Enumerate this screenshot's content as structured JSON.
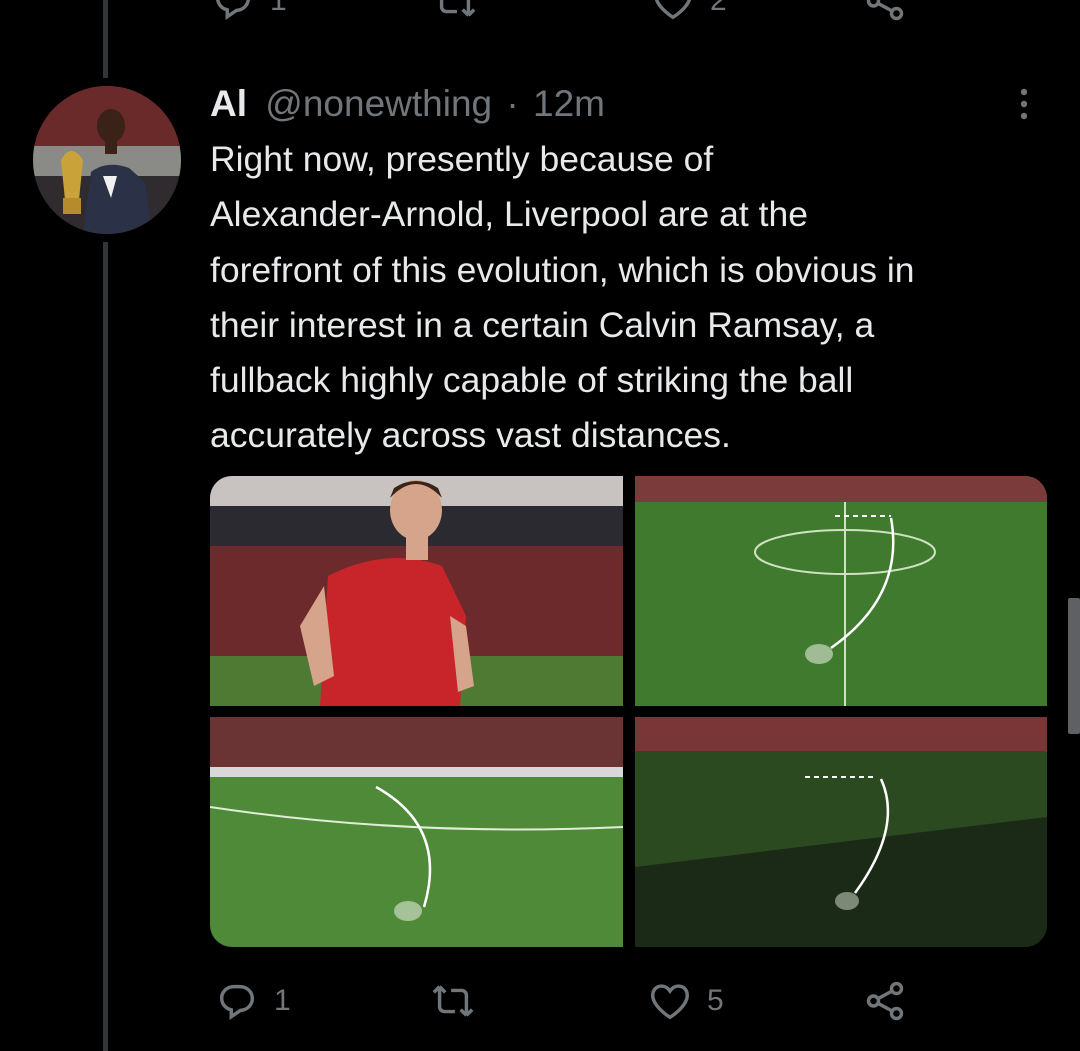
{
  "previous_tweet": {
    "actions": {
      "reply_count": "1",
      "like_count": "2"
    }
  },
  "tweet": {
    "author_name": "Al",
    "handle": "@nonewthing",
    "separator": "·",
    "time": "12m",
    "text": "Right now, presently because of\nAlexander-Arnold, Liverpool are at the\nforefront of this evolution, which is obvious in\ntheir interest in a certain Calvin Ramsay, a\nfullback highly capable of striking the ball\naccurately across vast distances.",
    "media": [
      {
        "kind": "photo",
        "subject": "player-red-kit"
      },
      {
        "kind": "photo",
        "subject": "pitch-pass-diagram"
      },
      {
        "kind": "photo",
        "subject": "pitch-pass-diagram"
      },
      {
        "kind": "photo",
        "subject": "pitch-pass-diagram"
      }
    ],
    "actions": {
      "reply_count": "1",
      "retweet_count": "",
      "like_count": "5"
    }
  },
  "icons": [
    "reply-icon",
    "retweet-icon",
    "like-icon",
    "share-icon",
    "more-icon"
  ],
  "colors": {
    "background": "#000000",
    "text_primary": "#e7e9ea",
    "text_secondary": "#71767b",
    "thread_line": "#333639"
  }
}
